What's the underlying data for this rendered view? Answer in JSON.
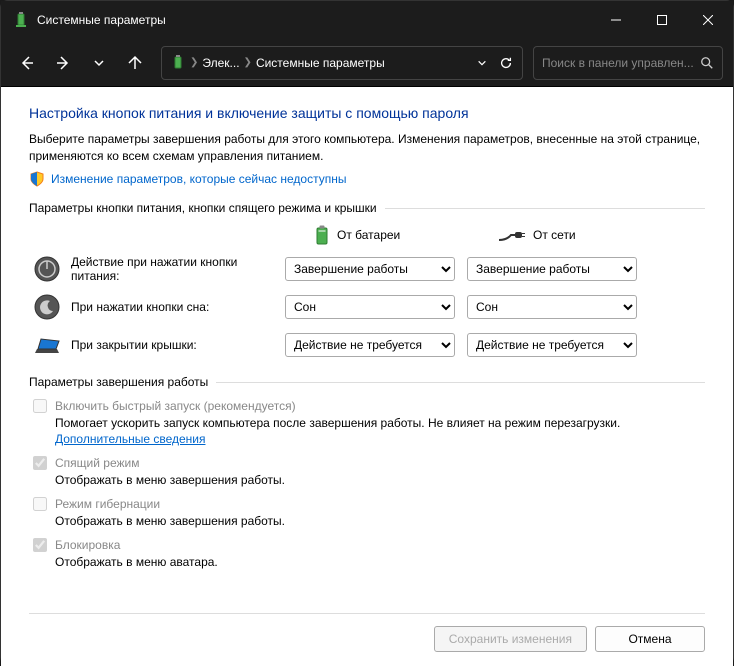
{
  "window": {
    "title": "Системные параметры"
  },
  "breadcrumb": {
    "item1": "Элек...",
    "item2": "Системные параметры"
  },
  "search": {
    "placeholder": "Поиск в панели управлен..."
  },
  "page": {
    "heading": "Настройка кнопок питания и включение защиты с помощью пароля",
    "description": "Выберите параметры завершения работы для этого компьютера. Изменения параметров, внесенные на этой странице, применяются ко всем схемам управления питанием.",
    "change_link": "Изменение параметров, которые сейчас недоступны"
  },
  "section1": {
    "title": "Параметры кнопки питания, кнопки спящего режима и крышки",
    "col_battery": "От батареи",
    "col_mains": "От сети",
    "rows": {
      "power": {
        "label": "Действие при нажатии кнопки питания:",
        "battery": "Завершение работы",
        "mains": "Завершение работы"
      },
      "sleep": {
        "label": "При нажатии кнопки сна:",
        "battery": "Сон",
        "mains": "Сон"
      },
      "lid": {
        "label": "При закрытии крышки:",
        "battery": "Действие не требуется",
        "mains": "Действие не требуется"
      }
    }
  },
  "section2": {
    "title": "Параметры завершения работы",
    "fast": {
      "label": "Включить быстрый запуск (рекомендуется)",
      "desc_a": "Помогает ускорить запуск компьютера после завершения работы. Не влияет на режим перезагрузки. ",
      "link": "Дополнительные сведения"
    },
    "sleep": {
      "label": "Спящий режим",
      "desc": "Отображать в меню завершения работы."
    },
    "hib": {
      "label": "Режим гибернации",
      "desc": "Отображать в меню завершения работы."
    },
    "lock": {
      "label": "Блокировка",
      "desc": "Отображать в меню аватара."
    }
  },
  "footer": {
    "save": "Сохранить изменения",
    "cancel": "Отмена"
  }
}
